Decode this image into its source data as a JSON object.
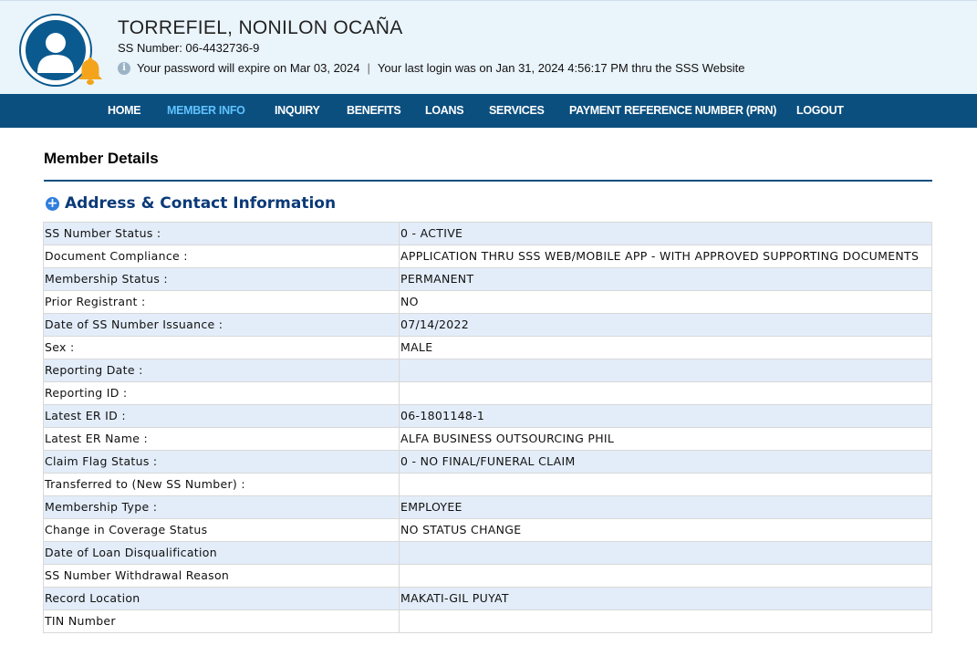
{
  "profile": {
    "name": "TORREFIEL, NONILON OCAÑA",
    "ss_number_line": "SS Number: 06-4432736-9",
    "password_notice": "Your password will expire on Mar 03, 2024",
    "separator": "|",
    "last_login_notice": "Your last login was on Jan 31, 2024 4:56:17 PM thru the SSS Website"
  },
  "nav": {
    "items": [
      "HOME",
      "MEMBER INFO",
      "INQUIRY",
      "BENEFITS",
      "LOANS",
      "SERVICES",
      "PAYMENT REFERENCE NUMBER (PRN)",
      "LOGOUT"
    ],
    "active": "MEMBER INFO"
  },
  "page": {
    "title": "Member Details",
    "section_title": "Address & Contact Information"
  },
  "details": [
    {
      "label": "SS Number Status :",
      "value": "0 - ACTIVE"
    },
    {
      "label": "Document Compliance :",
      "value": "APPLICATION THRU SSS WEB/MOBILE APP - WITH APPROVED SUPPORTING DOCUMENTS"
    },
    {
      "label": "Membership Status :",
      "value": "PERMANENT"
    },
    {
      "label": "Prior Registrant :",
      "value": "NO"
    },
    {
      "label": "Date of SS Number Issuance :",
      "value": "07/14/2022"
    },
    {
      "label": "Sex :",
      "value": "MALE"
    },
    {
      "label": "Reporting Date :",
      "value": ""
    },
    {
      "label": "Reporting ID :",
      "value": ""
    },
    {
      "label": "Latest ER ID :",
      "value": "06-1801148-1"
    },
    {
      "label": "Latest ER Name :",
      "value": "ALFA BUSINESS OUTSOURCING PHIL"
    },
    {
      "label": "Claim Flag Status :",
      "value": "0 - NO FINAL/FUNERAL CLAIM"
    },
    {
      "label": "Transferred to (New SS Number) :",
      "value": ""
    },
    {
      "label": "Membership Type :",
      "value": "EMPLOYEE"
    },
    {
      "label": "Change in Coverage Status",
      "value": "NO STATUS CHANGE"
    },
    {
      "label": "Date of Loan Disqualification",
      "value": ""
    },
    {
      "label": "SS Number Withdrawal Reason",
      "value": ""
    },
    {
      "label": "Record Location",
      "value": "MAKATI-GIL PUYAT"
    },
    {
      "label": "TIN Number",
      "value": ""
    }
  ],
  "colors": {
    "header_bg": "#eaf4fb",
    "nav_bg": "#0b4f7f",
    "nav_active": "#5fc3ff",
    "row_shade": "#e3edf9",
    "section_title": "#0b3a78"
  },
  "icons": [
    "user-avatar-icon",
    "notification-bell-icon",
    "info-icon",
    "expand-plus-icon"
  ]
}
